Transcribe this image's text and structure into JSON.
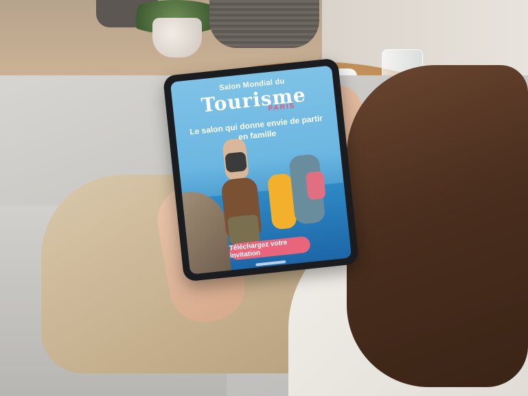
{
  "tablet_screen": {
    "logo": {
      "top_line": "Salon Mondial du",
      "wordmark": "Tourisme",
      "city": "PARIS"
    },
    "headline": "Le salon qui donne envie de partir en famille",
    "cta_button_label": "Téléchargez votre invitation"
  },
  "colors": {
    "cta_pink": "#e9657b",
    "sky_blue": "#7fc2e6",
    "sea_blue": "#1d66a8",
    "tablet_bezel": "#1b1c1f"
  }
}
